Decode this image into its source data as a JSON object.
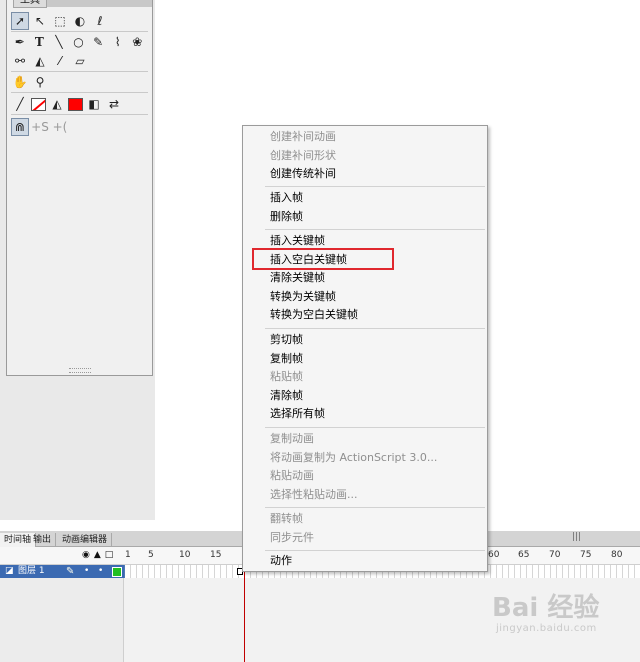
{
  "tools_panel": {
    "title": "工具"
  },
  "timeline": {
    "tabs": [
      "时间轴",
      "输出",
      "动画编辑器"
    ],
    "ruler_left": [
      "1",
      "5",
      "10",
      "15"
    ],
    "ruler_right": [
      "60",
      "65",
      "70",
      "75",
      "80"
    ],
    "layer_name": "图层 1"
  },
  "context_menu": {
    "groups": [
      [
        {
          "label": "创建补间动画",
          "enabled": false
        },
        {
          "label": "创建补间形状",
          "enabled": false
        },
        {
          "label": "创建传统补间",
          "enabled": true
        }
      ],
      [
        {
          "label": "插入帧",
          "enabled": true
        },
        {
          "label": "删除帧",
          "enabled": true
        }
      ],
      [
        {
          "label": "插入关键帧",
          "enabled": true
        },
        {
          "label": "插入空白关键帧",
          "enabled": true
        },
        {
          "label": "清除关键帧",
          "enabled": true
        },
        {
          "label": "转换为关键帧",
          "enabled": true
        },
        {
          "label": "转换为空白关键帧",
          "enabled": true
        }
      ],
      [
        {
          "label": "剪切帧",
          "enabled": true
        },
        {
          "label": "复制帧",
          "enabled": true
        },
        {
          "label": "粘贴帧",
          "enabled": false
        },
        {
          "label": "清除帧",
          "enabled": true
        },
        {
          "label": "选择所有帧",
          "enabled": true
        }
      ],
      [
        {
          "label": "复制动画",
          "enabled": false
        },
        {
          "label": "将动画复制为 ActionScript 3.0...",
          "enabled": false
        },
        {
          "label": "粘贴动画",
          "enabled": false
        },
        {
          "label": "选择性粘贴动画...",
          "enabled": false
        }
      ],
      [
        {
          "label": "翻转帧",
          "enabled": false
        },
        {
          "label": "同步元件",
          "enabled": false
        }
      ],
      [
        {
          "label": "动作",
          "enabled": true
        }
      ]
    ],
    "highlighted": "插入空白关键帧"
  },
  "watermark": {
    "logo": "Bai 经验",
    "url": "jingyan.baidu.com"
  },
  "colors": {
    "fill": "#ff0000",
    "highlight_box": "#e0282e",
    "layer_selected": "#3b6ab2",
    "playhead": "#c00000"
  }
}
